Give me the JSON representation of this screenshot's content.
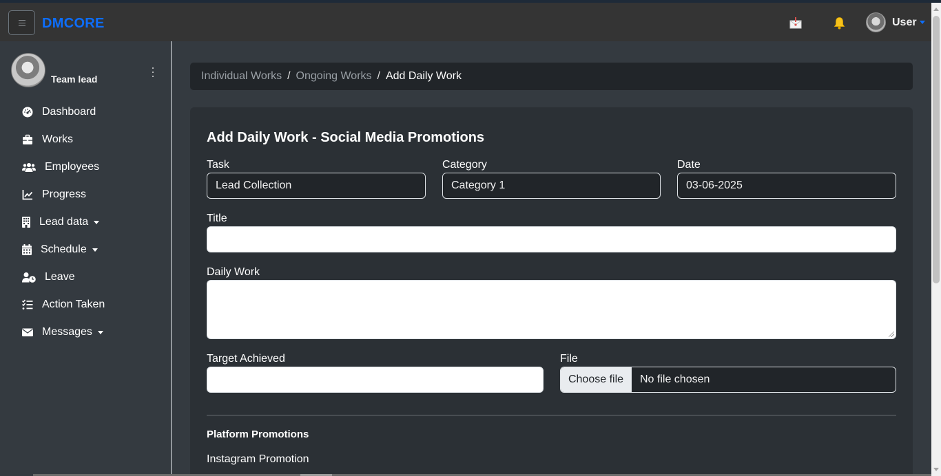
{
  "app": {
    "brand": "DMCORE"
  },
  "navbar": {
    "user_name": "User",
    "icons": [
      "hamburger-icon",
      "mail-icon",
      "bell-icon",
      "avatar"
    ]
  },
  "sidebar": {
    "role": "Team lead",
    "items": [
      {
        "label": "Dashboard",
        "icon": "dashboard-icon",
        "dropdown": false
      },
      {
        "label": "Works",
        "icon": "briefcase-icon",
        "dropdown": false
      },
      {
        "label": "Employees",
        "icon": "users-icon",
        "dropdown": false
      },
      {
        "label": "Progress",
        "icon": "chart-line-icon",
        "dropdown": false
      },
      {
        "label": "Lead data",
        "icon": "building-icon",
        "dropdown": true
      },
      {
        "label": "Schedule",
        "icon": "calendar-icon",
        "dropdown": true
      },
      {
        "label": "Leave",
        "icon": "user-clock-icon",
        "dropdown": false
      },
      {
        "label": "Action Taken",
        "icon": "list-check-icon",
        "dropdown": false
      },
      {
        "label": "Messages",
        "icon": "envelope-icon",
        "dropdown": true
      }
    ]
  },
  "breadcrumb": {
    "items": [
      "Individual Works",
      "Ongoing Works"
    ],
    "active": "Add Daily Work"
  },
  "form": {
    "title": "Add Daily Work - Social Media Promotions",
    "task": {
      "label": "Task",
      "value": "Lead Collection"
    },
    "category": {
      "label": "Category",
      "value": "Category 1"
    },
    "date": {
      "label": "Date",
      "value": "03-06-2025"
    },
    "work_title": {
      "label": "Title",
      "value": ""
    },
    "daily_work": {
      "label": "Daily Work",
      "value": ""
    },
    "target": {
      "label": "Target Achieved",
      "value": ""
    },
    "file": {
      "label": "File",
      "button": "Choose file",
      "status": "No file chosen"
    }
  },
  "platform": {
    "heading": "Platform Promotions",
    "items": [
      "Instagram Promotion"
    ]
  },
  "colors": {
    "brand": "#0d6efd",
    "sidebar_bg": "#343a40",
    "navbar_bg": "#343434",
    "card_bg": "#2b3035",
    "input_dark": "#212529"
  }
}
